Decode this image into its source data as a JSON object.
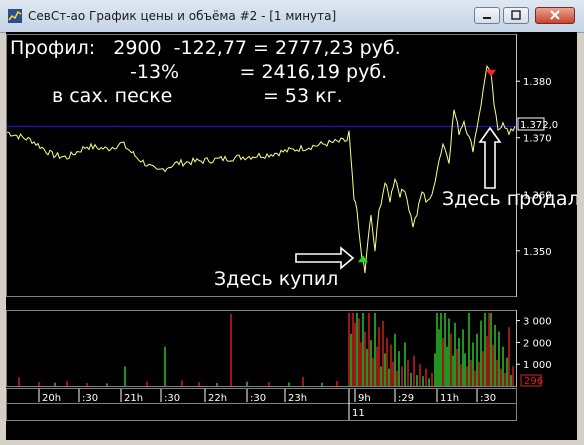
{
  "window": {
    "title": "СевСт-ао График цены и объёма #2 - [1 минута]",
    "minimize_icon": "minimize-icon",
    "restore_icon": "restore-icon",
    "close_icon": "close-icon"
  },
  "overlay": {
    "line1": "Профил:   2900  -122,77 = 2777,23 руб.",
    "line2": "-13%          = 2416,19 руб.",
    "line3": "в сах. песке               = 53 кг.",
    "bought_label": "Здесь купил",
    "sold_label": "Здесь продал"
  },
  "colors": {
    "background": "#000000",
    "price_line": "#ffff88",
    "level_line": "#1c1ce0",
    "volume_up": "#2fd12f",
    "volume_down": "#e02020",
    "buy_marker": "#22dd22",
    "sell_marker": "#ff2020",
    "axis_text": "#ffffff"
  },
  "price_axis": {
    "ticks": [
      "1.380",
      "1.370",
      "1.360",
      "1.350"
    ],
    "current_value": "1.372,0"
  },
  "volume_axis": {
    "ticks": [
      "3 000",
      "2 000",
      "1 000"
    ],
    "current_value": "296"
  },
  "time_axis": {
    "ticks": [
      "20h",
      ":30",
      "21h",
      ":30",
      "22h",
      ":30",
      "23h",
      "9h",
      ":29",
      "11h",
      ":30"
    ],
    "day_label": "11"
  },
  "chart_data": {
    "type": "line",
    "ylim": [
      1.342,
      1.388
    ],
    "level": 1.372,
    "price_series": [
      {
        "x": 0,
        "y": 1.371
      },
      {
        "x": 25,
        "y": 1.3695
      },
      {
        "x": 45,
        "y": 1.367
      },
      {
        "x": 60,
        "y": 1.3665
      },
      {
        "x": 80,
        "y": 1.3685
      },
      {
        "x": 100,
        "y": 1.368
      },
      {
        "x": 115,
        "y": 1.369
      },
      {
        "x": 130,
        "y": 1.3665
      },
      {
        "x": 150,
        "y": 1.364
      },
      {
        "x": 170,
        "y": 1.3655
      },
      {
        "x": 200,
        "y": 1.366
      },
      {
        "x": 230,
        "y": 1.3665
      },
      {
        "x": 260,
        "y": 1.367
      },
      {
        "x": 290,
        "y": 1.368
      },
      {
        "x": 320,
        "y": 1.369
      },
      {
        "x": 340,
        "y": 1.3695
      },
      {
        "x": 342,
        "y": 1.371
      },
      {
        "x": 344,
        "y": 1.366
      },
      {
        "x": 347,
        "y": 1.359
      },
      {
        "x": 350,
        "y": 1.357
      },
      {
        "x": 352,
        "y": 1.353
      },
      {
        "x": 355,
        "y": 1.349
      },
      {
        "x": 358,
        "y": 1.346
      },
      {
        "x": 361,
        "y": 1.352
      },
      {
        "x": 364,
        "y": 1.356
      },
      {
        "x": 368,
        "y": 1.35
      },
      {
        "x": 372,
        "y": 1.357
      },
      {
        "x": 378,
        "y": 1.362
      },
      {
        "x": 383,
        "y": 1.359
      },
      {
        "x": 388,
        "y": 1.363
      },
      {
        "x": 393,
        "y": 1.36
      },
      {
        "x": 398,
        "y": 1.361
      },
      {
        "x": 402,
        "y": 1.3575
      },
      {
        "x": 406,
        "y": 1.3545
      },
      {
        "x": 410,
        "y": 1.3565
      },
      {
        "x": 415,
        "y": 1.3605
      },
      {
        "x": 419,
        "y": 1.359
      },
      {
        "x": 425,
        "y": 1.3595
      },
      {
        "x": 430,
        "y": 1.3645
      },
      {
        "x": 436,
        "y": 1.369
      },
      {
        "x": 442,
        "y": 1.366
      },
      {
        "x": 447,
        "y": 1.375
      },
      {
        "x": 452,
        "y": 1.371
      },
      {
        "x": 457,
        "y": 1.373
      },
      {
        "x": 462,
        "y": 1.37
      },
      {
        "x": 466,
        "y": 1.368
      },
      {
        "x": 470,
        "y": 1.372
      },
      {
        "x": 476,
        "y": 1.378
      },
      {
        "x": 480,
        "y": 1.383
      },
      {
        "x": 484,
        "y": 1.381
      },
      {
        "x": 487,
        "y": 1.376
      },
      {
        "x": 491,
        "y": 1.371
      },
      {
        "x": 496,
        "y": 1.373
      },
      {
        "x": 502,
        "y": 1.3705
      },
      {
        "x": 508,
        "y": 1.372
      }
    ],
    "buy_point": {
      "x": 356,
      "y": 1.3485
    },
    "sell_point": {
      "x": 484,
      "y": 1.3815
    },
    "volume_bars": [
      {
        "x": 12,
        "v": 400,
        "dir": "down"
      },
      {
        "x": 32,
        "v": 180,
        "dir": "down"
      },
      {
        "x": 48,
        "v": 150,
        "dir": "up"
      },
      {
        "x": 60,
        "v": 220,
        "dir": "down"
      },
      {
        "x": 80,
        "v": 140,
        "dir": "down"
      },
      {
        "x": 100,
        "v": 120,
        "dir": "up"
      },
      {
        "x": 118,
        "v": 900,
        "dir": "up"
      },
      {
        "x": 140,
        "v": 200,
        "dir": "down"
      },
      {
        "x": 158,
        "v": 1800,
        "dir": "up"
      },
      {
        "x": 175,
        "v": 250,
        "dir": "down"
      },
      {
        "x": 192,
        "v": 180,
        "dir": "down"
      },
      {
        "x": 210,
        "v": 140,
        "dir": "up"
      },
      {
        "x": 224,
        "v": 3300,
        "dir": "down"
      },
      {
        "x": 240,
        "v": 200,
        "dir": "up"
      },
      {
        "x": 262,
        "v": 180,
        "dir": "down"
      },
      {
        "x": 282,
        "v": 160,
        "dir": "up"
      },
      {
        "x": 296,
        "v": 420,
        "dir": "down"
      },
      {
        "x": 315,
        "v": 150,
        "dir": "up"
      },
      {
        "x": 330,
        "v": 230,
        "dir": "down"
      },
      {
        "x": 342,
        "v": 3350,
        "dir": "down"
      },
      {
        "x": 344,
        "v": 2400,
        "dir": "up"
      },
      {
        "x": 346,
        "v": 3350,
        "dir": "down"
      },
      {
        "x": 348,
        "v": 2900,
        "dir": "down"
      },
      {
        "x": 350,
        "v": 3350,
        "dir": "up"
      },
      {
        "x": 352,
        "v": 3100,
        "dir": "down"
      },
      {
        "x": 354,
        "v": 2000,
        "dir": "down"
      },
      {
        "x": 356,
        "v": 3350,
        "dir": "up"
      },
      {
        "x": 358,
        "v": 2500,
        "dir": "down"
      },
      {
        "x": 360,
        "v": 1700,
        "dir": "up"
      },
      {
        "x": 362,
        "v": 3350,
        "dir": "down"
      },
      {
        "x": 364,
        "v": 2100,
        "dir": "up"
      },
      {
        "x": 366,
        "v": 1300,
        "dir": "down"
      },
      {
        "x": 368,
        "v": 3350,
        "dir": "up"
      },
      {
        "x": 370,
        "v": 1800,
        "dir": "down"
      },
      {
        "x": 372,
        "v": 2700,
        "dir": "down"
      },
      {
        "x": 374,
        "v": 900,
        "dir": "up"
      },
      {
        "x": 376,
        "v": 3000,
        "dir": "down"
      },
      {
        "x": 378,
        "v": 1500,
        "dir": "up"
      },
      {
        "x": 380,
        "v": 2200,
        "dir": "down"
      },
      {
        "x": 382,
        "v": 800,
        "dir": "up"
      },
      {
        "x": 384,
        "v": 1900,
        "dir": "down"
      },
      {
        "x": 386,
        "v": 1100,
        "dir": "down"
      },
      {
        "x": 388,
        "v": 2400,
        "dir": "up"
      },
      {
        "x": 390,
        "v": 700,
        "dir": "down"
      },
      {
        "x": 392,
        "v": 1600,
        "dir": "up"
      },
      {
        "x": 395,
        "v": 900,
        "dir": "down"
      },
      {
        "x": 398,
        "v": 2000,
        "dir": "up"
      },
      {
        "x": 401,
        "v": 1200,
        "dir": "down"
      },
      {
        "x": 404,
        "v": 600,
        "dir": "up"
      },
      {
        "x": 407,
        "v": 1400,
        "dir": "down"
      },
      {
        "x": 410,
        "v": 500,
        "dir": "up"
      },
      {
        "x": 413,
        "v": 1000,
        "dir": "down"
      },
      {
        "x": 416,
        "v": 450,
        "dir": "up"
      },
      {
        "x": 419,
        "v": 800,
        "dir": "down"
      },
      {
        "x": 422,
        "v": 350,
        "dir": "up"
      },
      {
        "x": 425,
        "v": 600,
        "dir": "down"
      },
      {
        "x": 428,
        "v": 1500,
        "dir": "up"
      },
      {
        "x": 430,
        "v": 3350,
        "dir": "up"
      },
      {
        "x": 432,
        "v": 2600,
        "dir": "up"
      },
      {
        "x": 434,
        "v": 3350,
        "dir": "up"
      },
      {
        "x": 436,
        "v": 2200,
        "dir": "down"
      },
      {
        "x": 438,
        "v": 3350,
        "dir": "up"
      },
      {
        "x": 440,
        "v": 1800,
        "dir": "up"
      },
      {
        "x": 442,
        "v": 3100,
        "dir": "up"
      },
      {
        "x": 444,
        "v": 2400,
        "dir": "down"
      },
      {
        "x": 446,
        "v": 1400,
        "dir": "up"
      },
      {
        "x": 448,
        "v": 2900,
        "dir": "up"
      },
      {
        "x": 450,
        "v": 1700,
        "dir": "down"
      },
      {
        "x": 452,
        "v": 2200,
        "dir": "up"
      },
      {
        "x": 454,
        "v": 1000,
        "dir": "down"
      },
      {
        "x": 456,
        "v": 2600,
        "dir": "up"
      },
      {
        "x": 458,
        "v": 1500,
        "dir": "up"
      },
      {
        "x": 460,
        "v": 900,
        "dir": "down"
      },
      {
        "x": 462,
        "v": 3350,
        "dir": "up"
      },
      {
        "x": 464,
        "v": 1200,
        "dir": "down"
      },
      {
        "x": 466,
        "v": 2000,
        "dir": "up"
      },
      {
        "x": 468,
        "v": 700,
        "dir": "down"
      },
      {
        "x": 470,
        "v": 2400,
        "dir": "up"
      },
      {
        "x": 472,
        "v": 1100,
        "dir": "down"
      },
      {
        "x": 474,
        "v": 3000,
        "dir": "up"
      },
      {
        "x": 476,
        "v": 1600,
        "dir": "down"
      },
      {
        "x": 478,
        "v": 3350,
        "dir": "up"
      },
      {
        "x": 480,
        "v": 2300,
        "dir": "down"
      },
      {
        "x": 482,
        "v": 3350,
        "dir": "down"
      },
      {
        "x": 484,
        "v": 3350,
        "dir": "up"
      },
      {
        "x": 486,
        "v": 1900,
        "dir": "down"
      },
      {
        "x": 488,
        "v": 2800,
        "dir": "up"
      },
      {
        "x": 490,
        "v": 1200,
        "dir": "down"
      },
      {
        "x": 492,
        "v": 2500,
        "dir": "up"
      },
      {
        "x": 494,
        "v": 800,
        "dir": "down"
      },
      {
        "x": 496,
        "v": 1800,
        "dir": "up"
      },
      {
        "x": 498,
        "v": 600,
        "dir": "down"
      },
      {
        "x": 500,
        "v": 1300,
        "dir": "up"
      },
      {
        "x": 502,
        "v": 2700,
        "dir": "down"
      },
      {
        "x": 504,
        "v": 500,
        "dir": "up"
      },
      {
        "x": 506,
        "v": 900,
        "dir": "down"
      }
    ]
  }
}
